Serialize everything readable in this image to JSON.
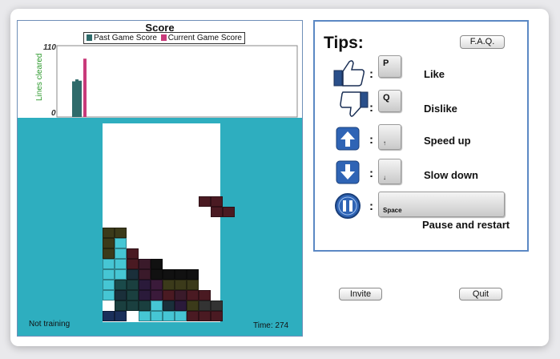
{
  "chart_data": {
    "type": "bar",
    "title": "Score",
    "ylabel": "Lines cleared",
    "ylim": [
      0,
      110
    ],
    "yticks": [
      "110",
      "0"
    ],
    "series": [
      {
        "name": "Past Game Score",
        "color": "#2f6b6b",
        "values": [
          55,
          58,
          56
        ]
      },
      {
        "name": "Current Game Score",
        "color": "#c83a7a",
        "values": [
          90
        ]
      }
    ],
    "grid": false
  },
  "game": {
    "status_left": "Not training",
    "time_label": "Time: 274"
  },
  "tips": {
    "title": "Tips:",
    "faq_label": "F.A.Q.",
    "rows": [
      {
        "icon": "thumbs-up-icon",
        "key": "P",
        "action": "Like"
      },
      {
        "icon": "thumbs-down-icon",
        "key": "Q",
        "action": "Dislike"
      },
      {
        "icon": "arrow-up-icon",
        "key": "↑",
        "action": "Speed up"
      },
      {
        "icon": "arrow-down-icon",
        "key": "↓",
        "action": "Slow down"
      },
      {
        "icon": "pause-icon",
        "key": "Space",
        "action": "Pause and restart"
      }
    ],
    "colon": ":"
  },
  "buttons": {
    "invite": "Invite",
    "quit": "Quit"
  },
  "colors": {
    "board_background": "#2eaebf",
    "panel_border": "#5b88c4"
  }
}
